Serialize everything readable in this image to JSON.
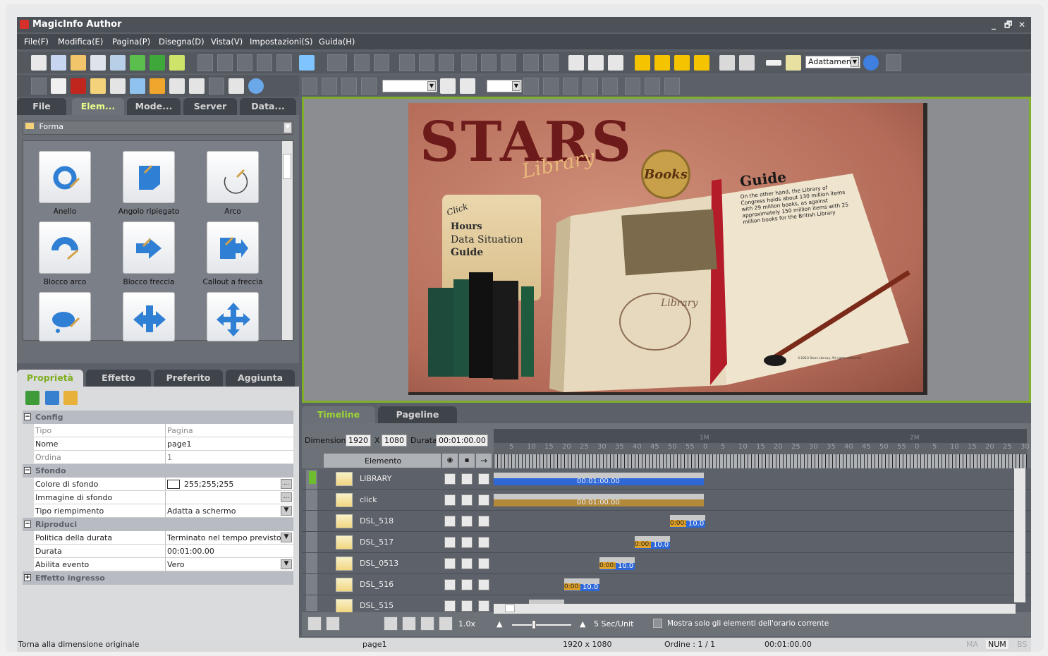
{
  "window": {
    "title": "MagicInfo Author",
    "controls": [
      "_",
      "🗗",
      "✕"
    ]
  },
  "menu": [
    "File(F)",
    "Modifica(E)",
    "Pagina(P)",
    "Disegna(D)",
    "Vista(V)",
    "Impostazioni(S)",
    "Guida(H)"
  ],
  "toolbar": {
    "zoom_value": "Adattamen"
  },
  "left_tabs": [
    "File",
    "Elem...",
    "Mode...",
    "Server",
    "Data..."
  ],
  "shape_category": "Forma",
  "shapes": [
    "Anello",
    "Angolo ripiegato",
    "Arco",
    "Blocco arco",
    "Blocco freccia",
    "Callout a freccia",
    "",
    "",
    ""
  ],
  "prop_tabs": [
    "Proprietà",
    "Effetto",
    "Preferito",
    "Aggiunta"
  ],
  "properties": {
    "sections": {
      "config": "Config",
      "sfondo": "Sfondo",
      "riproduci": "Riproduci",
      "effetto": "Effetto ingresso"
    },
    "tipo": {
      "k": "Tipo",
      "v": "Pagina"
    },
    "nome": {
      "k": "Nome",
      "v": "page1"
    },
    "ordine": {
      "k": "Ordina",
      "v": "1"
    },
    "colore": {
      "k": "Colore di sfondo",
      "v": "255;255;255"
    },
    "immagine": {
      "k": "Immagine di sfondo",
      "v": ""
    },
    "riempimento": {
      "k": "Tipo riempimento",
      "v": "Adatta a schermo"
    },
    "politica": {
      "k": "Politica della durata",
      "v": "Terminato nel tempo previsto"
    },
    "durata": {
      "k": "Durata",
      "v": "00:01:00.00"
    },
    "evento": {
      "k": "Abilita evento",
      "v": "Vero"
    }
  },
  "canvas": {
    "title": "STARS",
    "script": "Library",
    "seal": "Books",
    "scroll_click": "Click",
    "scroll_lines": [
      "Hours",
      "Data Situation",
      "Guide"
    ],
    "guide_title": "Guide",
    "guide_text": "On the other hand, the Library of Congress holds about 130 million items with 29 million books, as against approximately 150 million items with 25 million books for the British Library",
    "page_library": "Library",
    "copyright": "©2010 Stars Library. All rights reserved"
  },
  "timeline_tabs": [
    "Timeline",
    "Pageline"
  ],
  "timeline": {
    "dim_label": "Dimensione",
    "width": "1920",
    "x": "X",
    "height": "1080",
    "dur_label": "Durata",
    "duration": "00:01:00.00",
    "col_element": "Elemento",
    "ticks_1": [
      "5",
      "10",
      "15",
      "20",
      "25",
      "30",
      "35",
      "40",
      "45",
      "50",
      "55",
      "0",
      "5",
      "10",
      "15",
      "20",
      "25",
      "30",
      "35",
      "40",
      "45",
      "50",
      "55",
      "0",
      "5",
      "10",
      "15",
      "20",
      "25",
      "30"
    ],
    "marker_1m": "1M",
    "marker_2m": "2M",
    "rows": [
      {
        "name": "LIBRARY",
        "bar_text": "00:01:00.00"
      },
      {
        "name": "click",
        "bar_text": "00:01:00.00"
      },
      {
        "name": "DSL_518",
        "bar_text_a": "0:00:",
        "bar_text_b": "10.0"
      },
      {
        "name": "DSL_517",
        "bar_text_a": "0:00:",
        "bar_text_b": "10.0"
      },
      {
        "name": "DSL_0513",
        "bar_text_a": "0:00:",
        "bar_text_b": "10.0"
      },
      {
        "name": "DSL_516",
        "bar_text_a": "0:00:",
        "bar_text_b": "10.0"
      },
      {
        "name": "DSL_515",
        "bar_text_a": "",
        "bar_text_b": ""
      }
    ],
    "speed": "1.0x",
    "scale": "5 Sec/Unit",
    "only_current": "Mostra solo gli elementi dell'orario corrente"
  },
  "status": {
    "hint": "Torna alla dimensione originale",
    "page": "page1",
    "size": "1920 x 1080",
    "order": "Ordine : 1 / 1",
    "time": "00:01:00.00",
    "ma": "MA",
    "num": "NUM",
    "bs": "BS"
  }
}
